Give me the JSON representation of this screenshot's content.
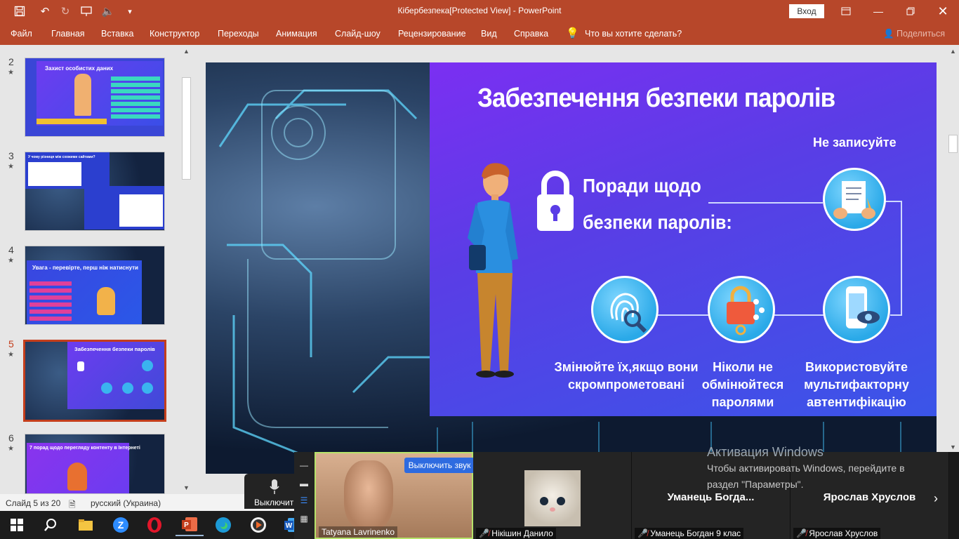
{
  "window": {
    "title": "Кібербезпека[Protected View]  -  PowerPoint",
    "signin": "Вход",
    "quick_icons": [
      "save-icon",
      "undo-icon",
      "redo-icon",
      "present-icon",
      "speaker-icon",
      "customize-icon"
    ]
  },
  "ribbon": {
    "tabs": [
      "Файл",
      "Главная",
      "Вставка",
      "Конструктор",
      "Переходы",
      "Анимация",
      "Слайд-шоу",
      "Рецензирование",
      "Вид",
      "Справка"
    ],
    "search": "Что вы хотите сделать?",
    "share": "Поделиться"
  },
  "thumbnails": [
    {
      "num": "2",
      "title": "Захист особистих даних"
    },
    {
      "num": "3",
      "title": "У чому різниця між схожими сайтами?"
    },
    {
      "num": "4",
      "title": "Увага - перевірте, перш ніж натиснути"
    },
    {
      "num": "5",
      "title": "Забезпечення безпеки паролів",
      "selected": true
    },
    {
      "num": "6",
      "title": "7 порад щодо перегляду контенту в Інтернеті"
    }
  ],
  "slide": {
    "title": "Забезпечення безпеки паролів",
    "advice_line1": "Поради щодо",
    "advice_line2": "безпеки паролів:",
    "dont_write": "Не записуйте",
    "tips": [
      {
        "line1": "Змінюйте їх,якщо вони",
        "line2": "скромпрометовані",
        "line3": ""
      },
      {
        "line1": "Ніколи не",
        "line2": "обмінюйтеся",
        "line3": "паролями"
      },
      {
        "line1": "Використовуйте",
        "line2": "мультифакторну",
        "line3": "автентифікацію"
      }
    ]
  },
  "statusbar": {
    "slide_of": "Слайд 5 из 20",
    "language": "русский (Украина)"
  },
  "zoom": {
    "mic_label": "Выключит",
    "mute_button": "Выключить звук",
    "more_button": "···",
    "participants": [
      {
        "name": "Tatyana Lavrinenko",
        "big": ""
      },
      {
        "name": "Нікішин Данило",
        "big": ""
      },
      {
        "name": "Уманець Богдан 9 клас",
        "big": "Уманець  Богда..."
      },
      {
        "name": "Ярослав Хруслов",
        "big": "Ярослав Хруслов"
      }
    ]
  },
  "activation": {
    "title": "Активация Windows",
    "line1": "Чтобы активировать Windows, перейдите в",
    "line2": "раздел \"Параметры\"."
  }
}
